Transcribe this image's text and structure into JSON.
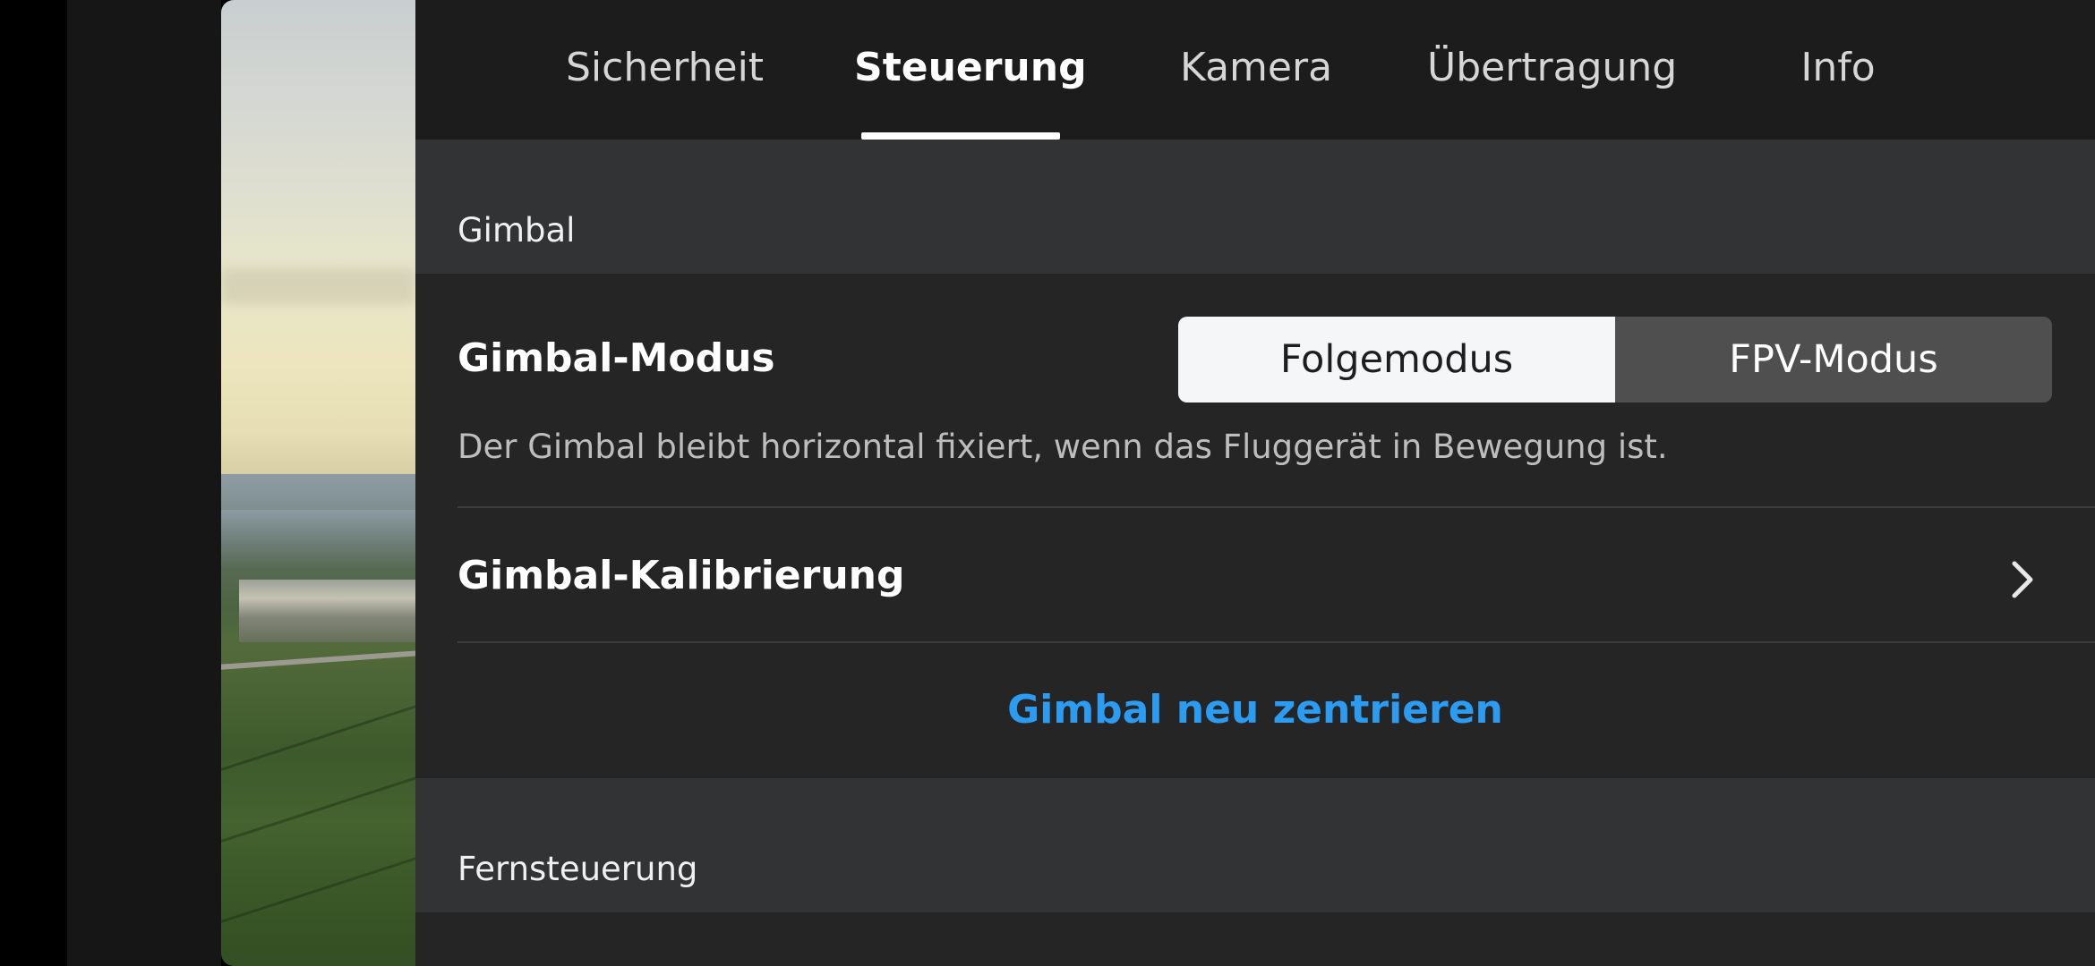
{
  "tabs": [
    {
      "label": "Sicherheit",
      "active": false
    },
    {
      "label": "Steuerung",
      "active": true
    },
    {
      "label": "Kamera",
      "active": false
    },
    {
      "label": "Übertragung",
      "active": false
    },
    {
      "label": "Info",
      "active": false
    }
  ],
  "gimbal_section": {
    "title": "Gimbal",
    "mode": {
      "label": "Gimbal-Modus",
      "options": [
        "Folgemodus",
        "FPV-Modus"
      ],
      "selected": "Folgemodus",
      "description": "Der Gimbal bleibt horizontal fixiert, wenn das Fluggerät in Bewegung ist."
    },
    "calibration": {
      "label": "Gimbal-Kalibrierung",
      "icon": "chevron-right-icon"
    },
    "recenter": {
      "label": "Gimbal neu zentrieren"
    }
  },
  "remote_section": {
    "title": "Fernsteuerung"
  },
  "colors": {
    "accent_link": "#2b9cf2",
    "tab_bar": "#1c1c1c",
    "section_header": "#323334",
    "content": "#252525"
  }
}
